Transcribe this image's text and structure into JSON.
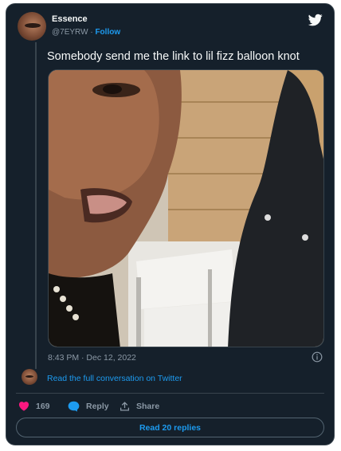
{
  "author": {
    "name": "Essence",
    "handle": "@7EYRW",
    "separator": "·",
    "follow_label": "Follow"
  },
  "tweet": {
    "text": "Somebody send me the link to lil fizz balloon knot",
    "timestamp": "8:43 PM · Dec 12, 2022"
  },
  "conversation": {
    "read_full_label": "Read the full conversation on Twitter"
  },
  "actions": {
    "likes": "169",
    "reply_label": "Reply",
    "share_label": "Share"
  },
  "read_replies_label": "Read 20 replies",
  "icons": {
    "logo": "twitter-bird-icon",
    "info": "info-icon",
    "like": "heart-icon",
    "reply": "speech-bubble-icon",
    "share": "share-upload-icon"
  },
  "colors": {
    "background": "#15202b",
    "accent": "#1d9bf0",
    "heart": "#f91880",
    "muted": "#8b98a5"
  }
}
